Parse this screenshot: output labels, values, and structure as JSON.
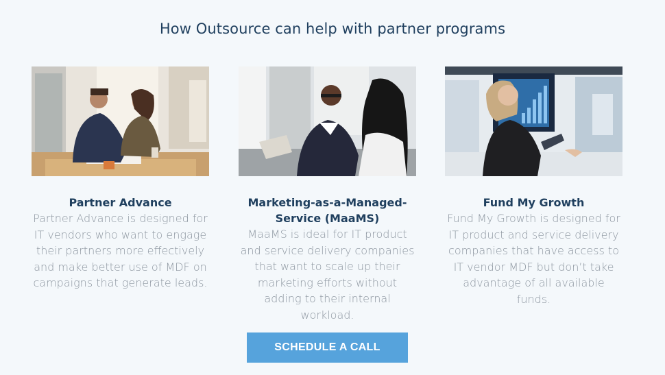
{
  "header": {
    "title": "How Outsource can help with partner programs"
  },
  "cards": [
    {
      "title": "Partner Advance",
      "description": "Partner Advance is designed for IT vendors who want to engage their partners more effectively and make better use of MDF on campaigns that generate leads.",
      "image": "photo-two-people-at-table-with-laptop"
    },
    {
      "title": "Marketing-as-a-Managed-Service (MaaMS)",
      "description": "MaaMS is ideal for IT product and service delivery companies that want to scale up their marketing efforts without adding to their internal workload.",
      "image": "photo-business-meeting"
    },
    {
      "title": "Fund My Growth",
      "description": "Fund My Growth is designed for IT product and service delivery companies that have access to IT vendor MDF but don’t take advantage of all available funds.",
      "image": "photo-woman-with-tablet-and-chart-screen"
    }
  ],
  "cta": {
    "label": "SCHEDULE A CALL",
    "color": "#56a3dc"
  },
  "colors": {
    "background": "#f4f8fb",
    "heading": "#1f3f5e",
    "body_text": "#8d96a0"
  }
}
